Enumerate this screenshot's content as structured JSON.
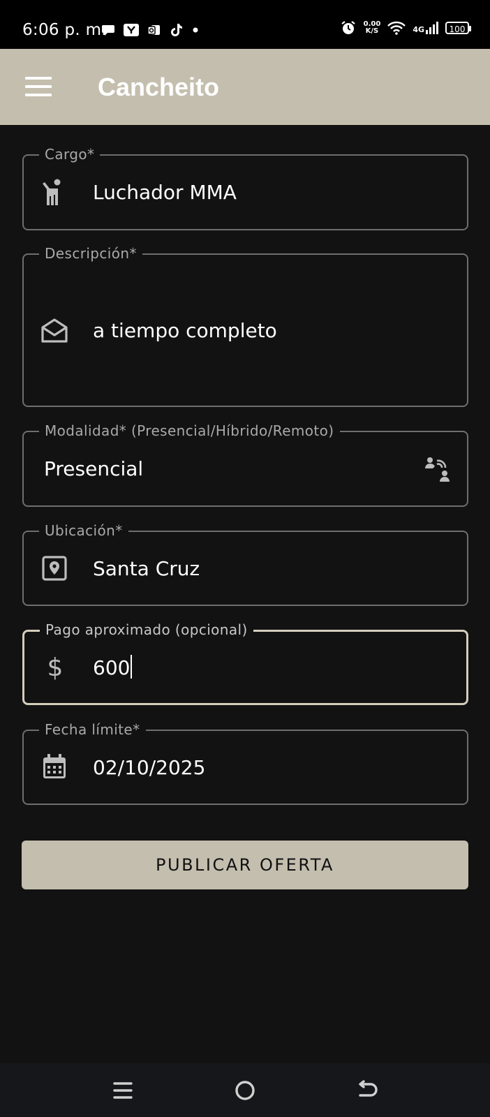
{
  "status_bar": {
    "time": "6:06 p. m.",
    "speed_value": "0.00",
    "speed_unit": "K/S",
    "network": "4G",
    "battery": "100"
  },
  "app_bar": {
    "title": "Cancheito"
  },
  "form": {
    "cargo": {
      "label": "Cargo*",
      "value": "Luchador MMA",
      "icon": "person-pose-icon"
    },
    "descripcion": {
      "label": "Descripción*",
      "value": "a tiempo completo",
      "icon": "envelope-open-icon"
    },
    "modalidad": {
      "label": "Modalidad* (Presencial/Híbrido/Remoto)",
      "value": "Presencial",
      "icon": "remote-connection-icon"
    },
    "ubicacion": {
      "label": "Ubicación*",
      "value": "Santa Cruz",
      "icon": "location-pin-icon"
    },
    "pago": {
      "label": "Pago aproximado (opcional)",
      "value": "600",
      "icon": "dollar-icon"
    },
    "fecha": {
      "label": "Fecha límite*",
      "value": "02/10/2025",
      "icon": "calendar-icon"
    }
  },
  "publish_button": {
    "label": "PUBLICAR OFERTA"
  },
  "colors": {
    "app_bar": "#c4beae",
    "background": "#121212",
    "field_border": "#6e6e6e",
    "focused_border": "#d4cdbd"
  }
}
